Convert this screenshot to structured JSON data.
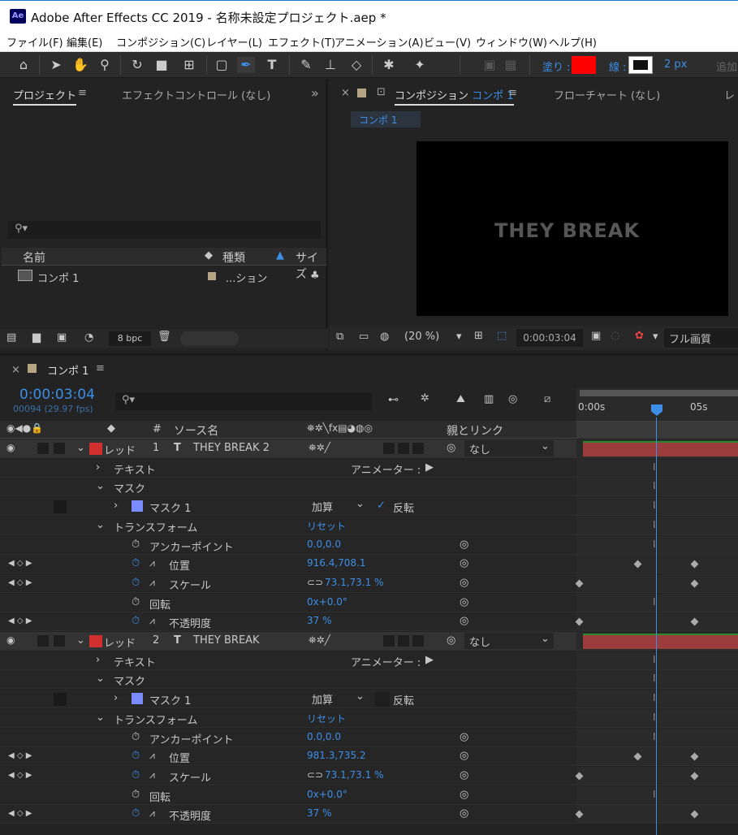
{
  "app": {
    "title": "Adobe After Effects CC 2019 - 名称未設定プロジェクト.aep *",
    "icon_label": "Ae"
  },
  "menu": [
    "ファイル(F)",
    "編集(E)",
    "コンポジション(C)",
    "レイヤー(L)",
    "エフェクト(T)",
    "アニメーション(A)",
    "ビュー(V)",
    "ウィンドウ(W)",
    "ヘルプ(H)"
  ],
  "toolbar": {
    "fill_label": "塗り :",
    "stroke_label": "線 :",
    "stroke_width": "2 px",
    "add_label": "追加",
    "fill_color": "#ff0000"
  },
  "project": {
    "tab": "プロジェクト",
    "tab2": "エフェクトコントロール (なし)",
    "col_name": "名前",
    "col_type": "種類",
    "col_size": "サイズ",
    "item_name": "コンポ 1",
    "item_type": "...ション",
    "bpc": "8 bpc"
  },
  "comp": {
    "tab": "コンポジション",
    "comp_name": "コンポ 1",
    "flowchart": "フローチャート (なし)",
    "crumb": "コンポ 1",
    "preview_text": "THEY BRE",
    "preview_text2": "AK",
    "zoom": "(20 %)",
    "time": "0:00:03:04",
    "quality": "フル画質"
  },
  "timeline": {
    "tab": "コンポ 1",
    "time": "0:00:03:04",
    "frames": "00094 (29.97 fps)",
    "col_hash": "#",
    "col_source": "ソース名",
    "col_parent": "親とリンク",
    "ruler": [
      "0:00s",
      "05s"
    ],
    "parent_none": "なし",
    "animator": "アニメーター :",
    "reset": "リセット",
    "mode": "加算",
    "invert": "反転"
  },
  "layers": [
    {
      "label": "レッド",
      "num": "1",
      "name": "THEY BREAK 2",
      "text": "テキスト",
      "mask": "マスク",
      "mask1": "マスク 1",
      "transform": "トランスフォーム",
      "props": [
        {
          "name": "アンカーポイント",
          "value": "0.0,0.0"
        },
        {
          "name": "位置",
          "value": "916.4,708.1"
        },
        {
          "name": "スケール",
          "value": "73.1,73.1 %"
        },
        {
          "name": "回転",
          "value": "0x+0.0°"
        },
        {
          "name": "不透明度",
          "value": "37 %"
        }
      ]
    },
    {
      "label": "レッド",
      "num": "2",
      "name": "THEY BREAK",
      "text": "テキスト",
      "mask": "マスク",
      "mask1": "マスク 1",
      "transform": "トランスフォーム",
      "props": [
        {
          "name": "アンカーポイント",
          "value": "0.0,0.0"
        },
        {
          "name": "位置",
          "value": "981.3,735.2"
        },
        {
          "name": "スケール",
          "value": "73.1,73.1 %"
        },
        {
          "name": "回転",
          "value": "0x+0.0°"
        },
        {
          "name": "不透明度",
          "value": "37 %"
        }
      ]
    }
  ]
}
